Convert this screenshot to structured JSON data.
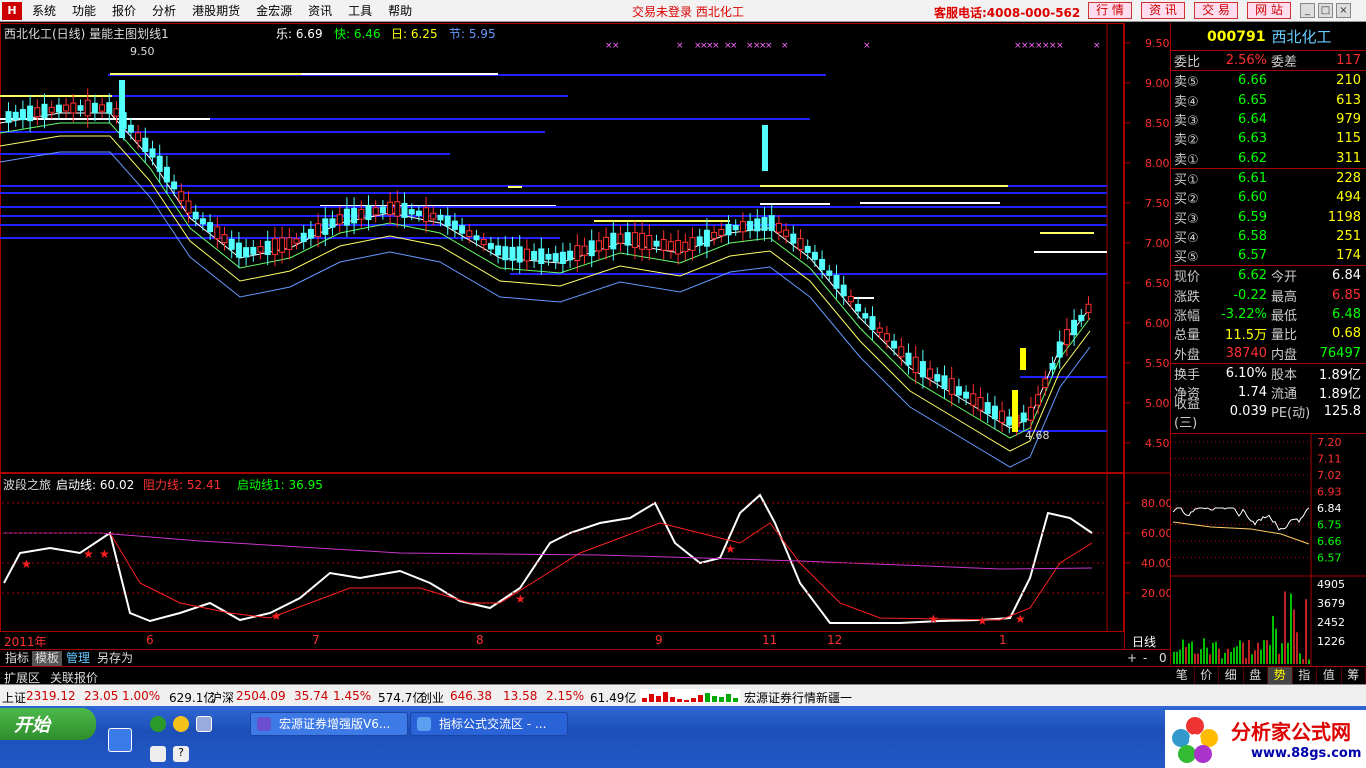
{
  "menu": {
    "items": [
      "系统",
      "功能",
      "报价",
      "分析",
      "港股期货",
      "金宏源",
      "资讯",
      "工具",
      "帮助"
    ],
    "status_text": "交易未登录  西北化工",
    "hotline": "客服电话:4008-000-562",
    "buttons": [
      "行 情",
      "资 讯",
      "交 易",
      "网 站"
    ]
  },
  "chart": {
    "main_title": "西北化工(日线) 量能主图划线1",
    "ind_le": "乐: 6.69",
    "ind_kuai": "快: 6.46",
    "ind_ri": "日: 6.25",
    "ind_jie": "节: 5.95",
    "high_label": "9.50",
    "low_label": "4.68",
    "lower_title": "波段之旅",
    "lower_start": "启动线: 60.02",
    "lower_resist": "阻力线: 52.41",
    "lower_start1": "启动线1: 36.95",
    "price_ticks": [
      "9.50",
      "9.00",
      "8.50",
      "8.00",
      "7.50",
      "7.00",
      "6.50",
      "6.00",
      "5.50",
      "5.00",
      "4.50"
    ],
    "osc_ticks": [
      "80.00",
      "60.00",
      "40.00",
      "20.00"
    ],
    "x_labels": [
      "2011年",
      "6",
      "7",
      "8",
      "9",
      "11",
      "12",
      "1"
    ],
    "period_label": "日线"
  },
  "quote": {
    "code": "000791",
    "name": "西北化工",
    "weibi_label": "委比",
    "weibi": "2.56%",
    "weicha_label": "委差",
    "weicha": "117",
    "asks": [
      {
        "label": "卖⑤",
        "price": "6.66",
        "vol": "210"
      },
      {
        "label": "卖④",
        "price": "6.65",
        "vol": "613"
      },
      {
        "label": "卖③",
        "price": "6.64",
        "vol": "979"
      },
      {
        "label": "卖②",
        "price": "6.63",
        "vol": "115"
      },
      {
        "label": "卖①",
        "price": "6.62",
        "vol": "311"
      }
    ],
    "bids": [
      {
        "label": "买①",
        "price": "6.61",
        "vol": "228"
      },
      {
        "label": "买②",
        "price": "6.60",
        "vol": "494"
      },
      {
        "label": "买③",
        "price": "6.59",
        "vol": "1198"
      },
      {
        "label": "买④",
        "price": "6.58",
        "vol": "251"
      },
      {
        "label": "买⑤",
        "price": "6.57",
        "vol": "174"
      }
    ],
    "stats": [
      {
        "l1": "现价",
        "v1": "6.62",
        "c1": "green",
        "l2": "今开",
        "v2": "6.84",
        "c2": "white"
      },
      {
        "l1": "涨跌",
        "v1": "-0.22",
        "c1": "green",
        "l2": "最高",
        "v2": "6.85",
        "c2": "red"
      },
      {
        "l1": "涨幅",
        "v1": "-3.22%",
        "c1": "green",
        "l2": "最低",
        "v2": "6.48",
        "c2": "green"
      },
      {
        "l1": "总量",
        "v1": "11.5万",
        "c1": "yellow",
        "l2": "量比",
        "v2": "0.68",
        "c2": "yellow"
      },
      {
        "l1": "外盘",
        "v1": "38740",
        "c1": "red",
        "l2": "内盘",
        "v2": "76497",
        "c2": "green"
      }
    ],
    "stats2": [
      {
        "l1": "换手",
        "v1": "6.10%",
        "l2": "股本",
        "v2": "1.89亿"
      },
      {
        "l1": "净资",
        "v1": "1.74",
        "l2": "流通",
        "v2": "1.89亿"
      },
      {
        "l1": "收益(三)",
        "v1": "0.039",
        "l2": "PE(动)",
        "v2": "125.8"
      }
    ]
  },
  "mini": {
    "price_ticks": [
      "7.20",
      "7.11",
      "7.02",
      "6.93",
      "6.84",
      "6.75",
      "6.66",
      "6.57"
    ],
    "vol_ticks": [
      "4905",
      "3679",
      "2452",
      "1226"
    ]
  },
  "tabs": {
    "chart_tabs": [
      "指标",
      "模板",
      "管理",
      "另存为"
    ],
    "ext_tabs": [
      "扩展区",
      "关联报价"
    ],
    "right_tabs": [
      "笔",
      "价",
      "细",
      "盘",
      "势",
      "指",
      "值",
      "筹"
    ],
    "zoom": [
      "+",
      "-",
      "0"
    ]
  },
  "indexbar": {
    "sh_label": "上证",
    "sh_val": "2319.12",
    "sh_chg": "23.05",
    "sh_pct": "1.00%",
    "sh_amt": "629.1亿",
    "hs_label": "沪深",
    "hs_val": "2504.09",
    "hs_chg": "35.74",
    "hs_pct": "1.45%",
    "hs_amt": "574.7亿",
    "cy_label": "创业",
    "cy_val": "646.38",
    "cy_chg": "13.58",
    "cy_pct": "2.15%",
    "cy_amt": "61.49亿",
    "news": "宏源证券行情新疆一"
  },
  "taskbar": {
    "start": "开始",
    "tasks": [
      "宏源证券增强版V6...",
      "指标公式交流区 - ..."
    ],
    "watermark": "分析家公式网",
    "watermark_url": "www.88gs.com"
  }
}
